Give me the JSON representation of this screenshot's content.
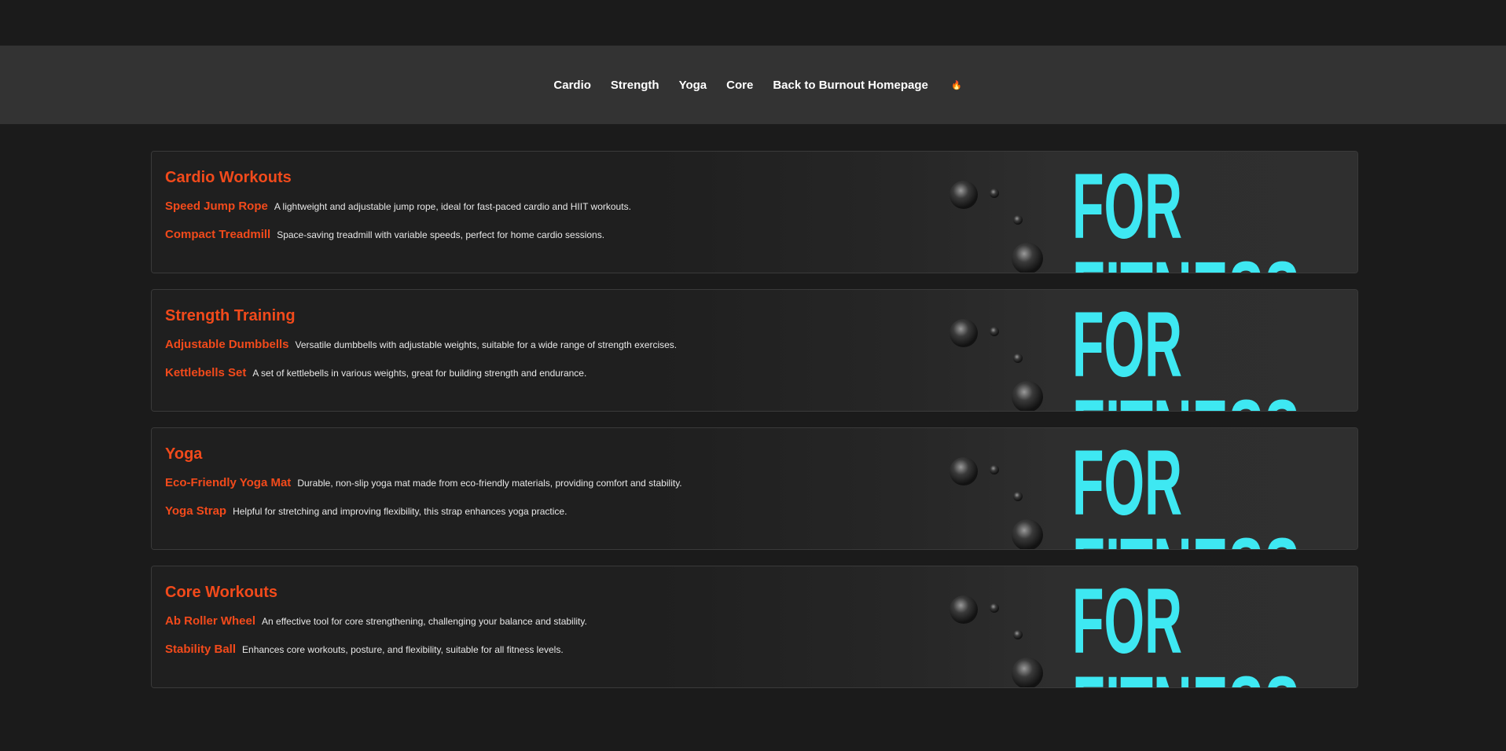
{
  "nav": {
    "links": [
      "Cardio",
      "Strength",
      "Yoga",
      "Core",
      "Back to Burnout Homepage"
    ],
    "fire_icon": "🔥"
  },
  "banner_text": {
    "line1": "FOR",
    "line2": "FITNESS"
  },
  "sections": [
    {
      "title": "Cardio Workouts",
      "items": [
        {
          "name": "Speed Jump Rope",
          "desc": "A lightweight and adjustable jump rope, ideal for fast-paced cardio and HIIT workouts."
        },
        {
          "name": "Compact Treadmill",
          "desc": "Space-saving treadmill with variable speeds, perfect for home cardio sessions."
        }
      ]
    },
    {
      "title": "Strength Training",
      "items": [
        {
          "name": "Adjustable Dumbbells",
          "desc": "Versatile dumbbells with adjustable weights, suitable for a wide range of strength exercises."
        },
        {
          "name": "Kettlebells Set",
          "desc": "A set of kettlebells in various weights, great for building strength and endurance."
        }
      ]
    },
    {
      "title": "Yoga",
      "items": [
        {
          "name": "Eco-Friendly Yoga Mat",
          "desc": "Durable, non-slip yoga mat made from eco-friendly materials, providing comfort and stability."
        },
        {
          "name": "Yoga Strap",
          "desc": "Helpful for stretching and improving flexibility, this strap enhances yoga practice."
        }
      ]
    },
    {
      "title": "Core Workouts",
      "items": [
        {
          "name": "Ab Roller Wheel",
          "desc": "An effective tool for core strengthening, challenging your balance and stability."
        },
        {
          "name": "Stability Ball",
          "desc": "Enhances core workouts, posture, and flexibility, suitable for all fitness levels."
        }
      ]
    }
  ],
  "colors": {
    "accent": "#f24a1b",
    "nav_bg": "#333333",
    "page_bg": "#1b1b1b",
    "banner_text": "#3ee8f2"
  }
}
